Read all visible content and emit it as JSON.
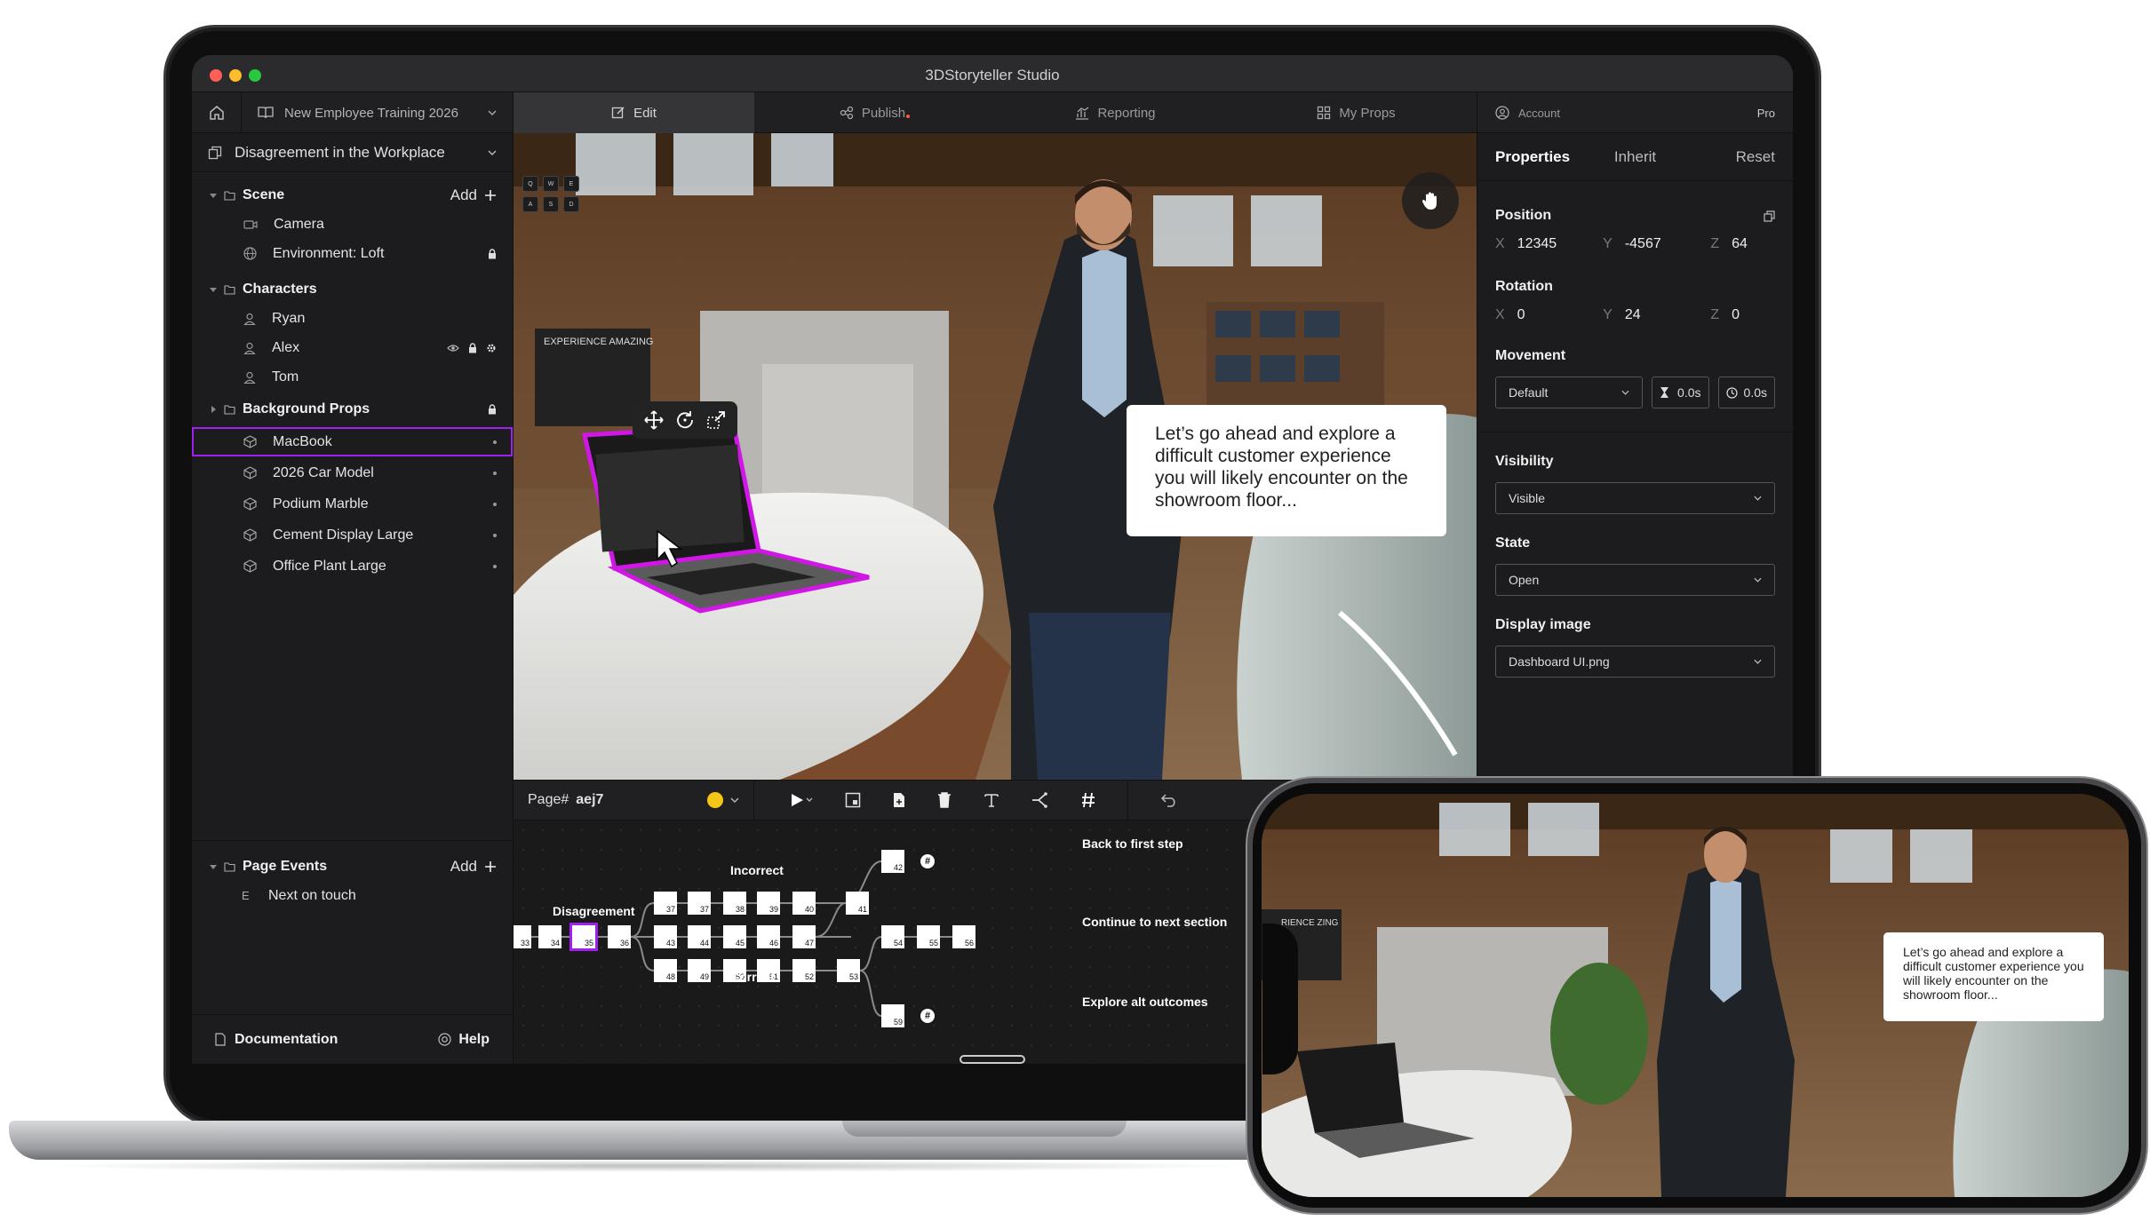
{
  "window": {
    "title": "3DStoryteller Studio"
  },
  "nav": {
    "project": "New Employee Training 2026",
    "tabs": [
      {
        "label": "Edit",
        "active": true
      },
      {
        "label": "Publish"
      },
      {
        "label": "Reporting"
      },
      {
        "label": "My Props"
      }
    ],
    "account": "Account",
    "plan": "Pro"
  },
  "lesson": "Disagreement in the Workplace",
  "scene": {
    "title": "Scene",
    "add_label": "Add",
    "items": [
      "Camera",
      "Environment: Loft"
    ]
  },
  "characters": {
    "title": "Characters",
    "items": [
      "Ryan",
      "Alex",
      "Tom"
    ]
  },
  "props": {
    "title": "Background Props",
    "items": [
      "MacBook",
      "2026 Car Model",
      "Podium Marble",
      "Cement Display Large",
      "Office Plant Large"
    ],
    "selected_index": 0
  },
  "page_events": {
    "title": "Page Events",
    "add_label": "Add",
    "items": [
      {
        "prefix": "E",
        "label": "Next on touch"
      }
    ]
  },
  "footer": {
    "docs": "Documentation",
    "help": "Help"
  },
  "viewport": {
    "keys": [
      "Q",
      "W",
      "E",
      "A",
      "S",
      "D"
    ],
    "caption": "Let’s go ahead and explore a difficult customer experience you will likely encounter on the showroom floor...",
    "sign": "EXPERIENCE AMAZING"
  },
  "timeline": {
    "page_label": "Page#",
    "page_id": "aej7",
    "labels": {
      "disagreement": "Disagreement",
      "incorrect": "Incorrect",
      "correct": "Correct",
      "back": "Back to first step",
      "continue": "Continue to next section",
      "explore": "Explore alt outcomes"
    },
    "main_nodes": [
      "33",
      "34",
      "35",
      "36"
    ],
    "selected_node": "35",
    "incorrect_nodes": [
      "37",
      "37",
      "38",
      "39",
      "40",
      "41"
    ],
    "middle_nodes": [
      "43",
      "44",
      "45",
      "46",
      "47"
    ],
    "correct_nodes": [
      "48",
      "49",
      "50",
      "51",
      "52",
      "53"
    ],
    "back_node": "42",
    "continue_nodes": [
      "54",
      "55",
      "56"
    ],
    "explore_node": "59",
    "hash": "#"
  },
  "properties": {
    "tabs": [
      "Properties",
      "Inherit",
      "Reset"
    ],
    "position": {
      "label": "Position",
      "x": "12345",
      "y": "-4567",
      "z": "64"
    },
    "rotation": {
      "label": "Rotation",
      "x": "0",
      "y": "24",
      "z": "0"
    },
    "axis": {
      "x": "X",
      "y": "Y",
      "z": "Z"
    },
    "movement": {
      "label": "Movement",
      "mode": "Default",
      "duration": "0.0s",
      "delay": "0.0s"
    },
    "visibility": {
      "label": "Visibility",
      "value": "Visible"
    },
    "state": {
      "label": "State",
      "value": "Open"
    },
    "display_image": {
      "label": "Display image",
      "value": "Dashboard UI.png"
    }
  },
  "phone": {
    "caption": "Let’s go ahead and explore a difficult customer experience you will likely encounter on the showroom floor...",
    "sign": "RIENCE ZING"
  },
  "colors": {
    "accent": "#a020f0",
    "yellow": "#f5c518"
  }
}
